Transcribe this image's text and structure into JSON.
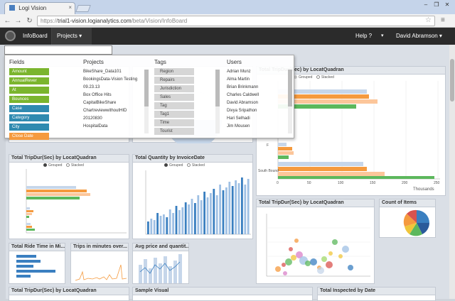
{
  "browser": {
    "tab_title": "Logi Vision",
    "tab_close": "×",
    "url_scheme": "https://",
    "url_host": "trial1-vision.logianalytics.com",
    "url_path": "/beta/Vision/InfoBoard",
    "window_buttons": [
      "–",
      "❐",
      "✕"
    ],
    "back_icon": "←",
    "forward_icon": "→",
    "reload_icon": "↻",
    "star_icon": "☆",
    "wrench_icon": "≡"
  },
  "header": {
    "nav": [
      "InfoBoard",
      "Projects ▾"
    ],
    "help": "Help ?",
    "user": "David Abramson ▾"
  },
  "search": {
    "placeholder": ""
  },
  "overlay": {
    "fields_title": "Fields",
    "fields": [
      {
        "label": "Amount",
        "color": "green"
      },
      {
        "label": "AnnualRever",
        "color": "green"
      },
      {
        "label": "At",
        "color": "green"
      },
      {
        "label": "Bounces",
        "color": "green"
      },
      {
        "label": "Case",
        "color": "teal"
      },
      {
        "label": "Category",
        "color": "teal"
      },
      {
        "label": "City",
        "color": "teal"
      },
      {
        "label": "Close Date",
        "color": "orange"
      }
    ],
    "projects_title": "Projects",
    "projects": [
      "BikeShare_Data101",
      "BookingsData-Vision Testing",
      "09.23.13",
      "Box Office Hits",
      "CapitalBikeShare",
      "ChartreviewwithoutHID",
      "20120830",
      "HospitalData"
    ],
    "tags_title": "Tags",
    "tags": [
      "Region",
      "Repairs",
      "Jurisdiction",
      "Sales",
      "Tag",
      "Tag1",
      "Time",
      "Tourist"
    ],
    "users_title": "Users",
    "users": [
      "Adrian Munz",
      "Alma Martin",
      "Brian Brinkmann",
      "Charles Caldwell",
      "David Abramson",
      "Divya Sripathon",
      "Hari Selhadi",
      "Jim Mousen"
    ]
  },
  "panels": {
    "top_right_title": "Total TripDur(Sec) by LocatQuadran",
    "legend": [
      "Grouped",
      "Stacked"
    ],
    "p1_title": "Total TripDur(Sec) by LocatQuadran",
    "p2_title": "Total Quantity by InvoiceDate",
    "p3_title": "Total TripDur(Sec) by LocatQuadran",
    "p4_title": "Count of Items",
    "p5_title": "Total Ride Time in Mi...",
    "p6_title": "Trips in minutes over...",
    "p7_title": "Avg price and quantit...",
    "p8_title": "Total TripDur(Sec) by LocatQuadran",
    "p9_title": "Sample Visual",
    "p10_title": "Total Inspected by Date",
    "right_axis_label": "Thousands",
    "right_axis_ticks": [
      "0",
      "50",
      "100",
      "150",
      "200",
      "250"
    ],
    "right_cat_label": "South Bound",
    "right_cat_label2": "F"
  },
  "colors": {
    "bar_blue": "#c6d6ea",
    "bar_orange": "#f59a3e",
    "bar_peach": "#fcc69a",
    "bar_green": "#5cb85c",
    "line_blue": "#3a7fc0"
  }
}
